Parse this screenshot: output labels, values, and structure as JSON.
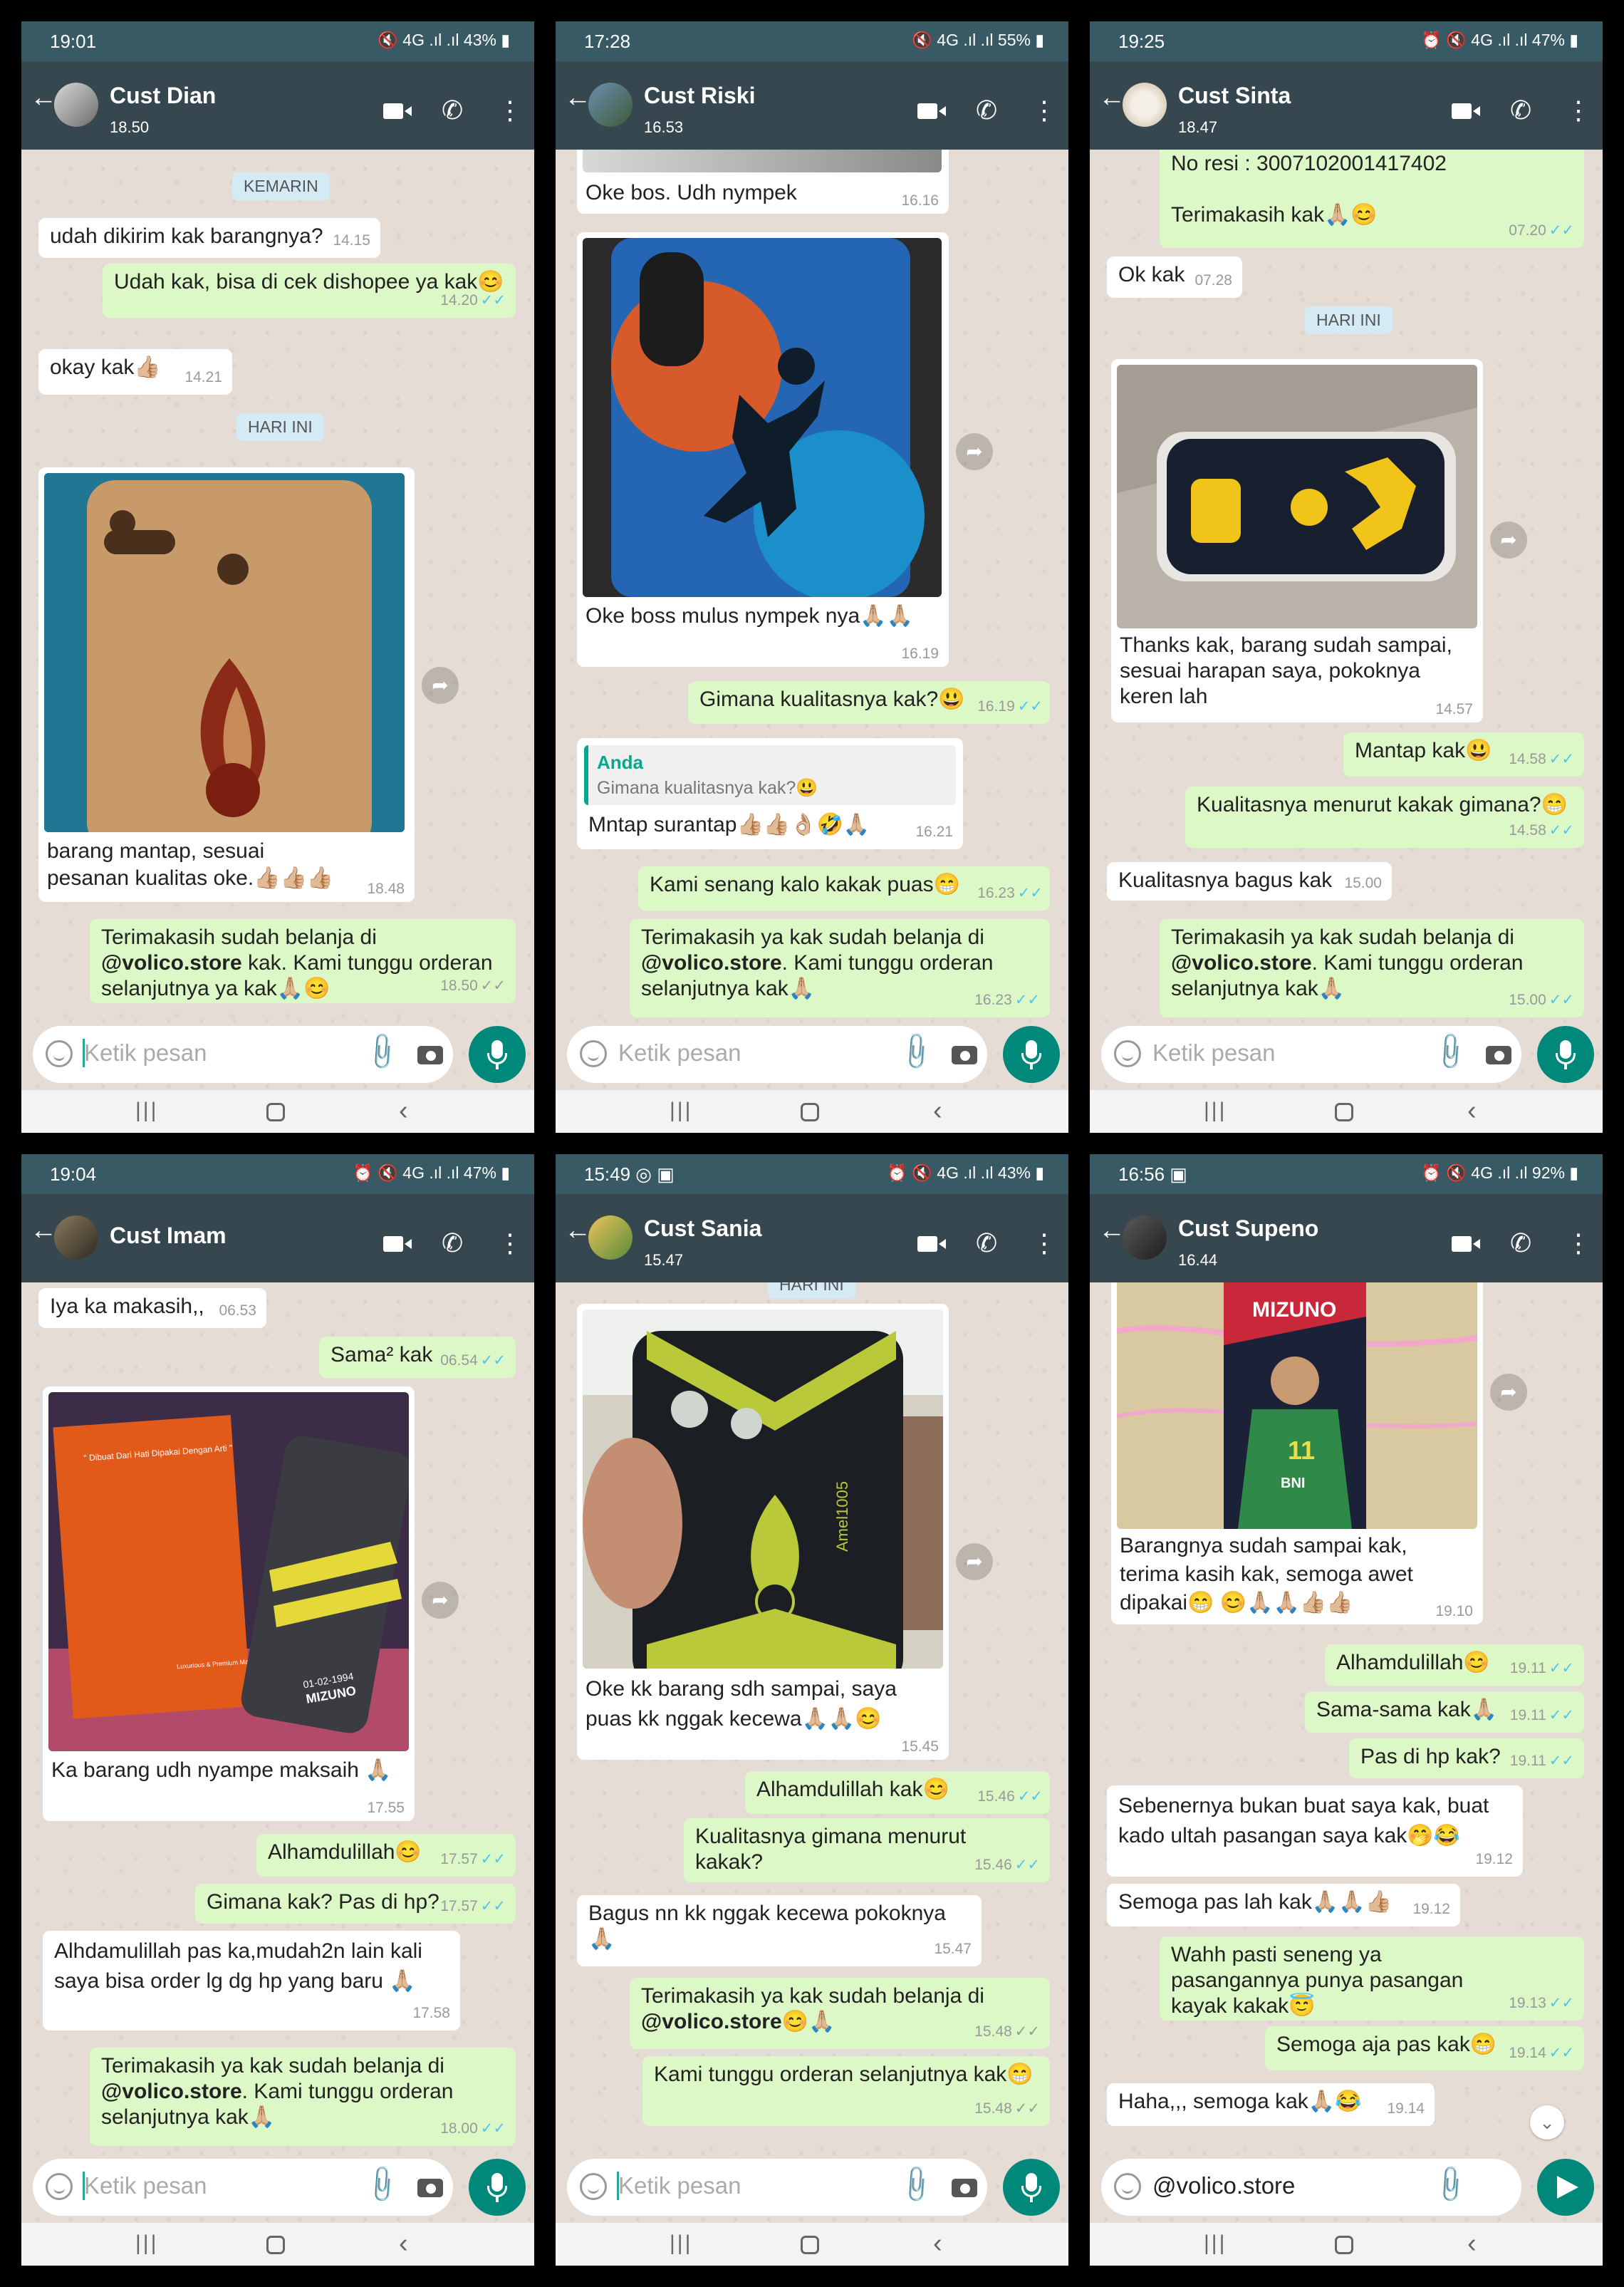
{
  "input_placeholder": "Ketik pesan",
  "panels": [
    {
      "status": {
        "time": "19:01",
        "right": "🔇 4G .ıl .ıl 43% ▮"
      },
      "name": "Cust Dian",
      "last_seen": "18.50",
      "date1": "KEMARIN",
      "date2": "HARI INI",
      "msgs": [
        {
          "text": "udah dikirim kak barangnya?",
          "time": "14.15"
        },
        {
          "text": "Udah kak, bisa di cek dishopee ya kak😊",
          "time": "14.20"
        },
        {
          "text": "okay kak👍🏼",
          "time": "14.21"
        },
        {
          "text": "barang mantap, sesuai pesanan kualitas oke.👍🏼👍🏼👍🏼",
          "time": "18.48"
        },
        {
          "pre": "Terimakasih sudah belanja di ",
          "store": "@volico.store",
          "post": " kak. Kami tunggu orderan selanjutnya ya kak🙏🏼😊",
          "time": "18.50"
        }
      ]
    },
    {
      "status": {
        "time": "17:28",
        "right": "🔇 4G .ıl .ıl 55% ▮"
      },
      "name": "Cust Riski",
      "last_seen": "16.53",
      "msgs": [
        {
          "text": "Oke bos. Udh nympek",
          "time": "16.16"
        },
        {
          "text": "Oke boss mulus nympek nya🙏🏼🙏🏼",
          "time": "16.19"
        },
        {
          "text": "Gimana kualitasnya kak?😃",
          "time": "16.19"
        },
        {
          "text": "Mntap surantap👍🏼👍🏼👌🏼🤣🙏🏼",
          "time": "16.21",
          "quote_who": "Anda",
          "quote_text": "Gimana kualitasnya kak?😃"
        },
        {
          "text": "Kami senang kalo kakak puas😁",
          "time": "16.23"
        },
        {
          "pre": "Terimakasih ya kak sudah belanja di ",
          "store": "@volico.store",
          "post": ". Kami tunggu orderan selanjutnya kak🙏🏼",
          "time": "16.23"
        }
      ]
    },
    {
      "status": {
        "time": "19:25",
        "right": "⏰ 🔇 4G .ıl .ıl 47% ▮"
      },
      "name": "Cust Sinta",
      "last_seen": "18.47",
      "date1": "HARI INI",
      "msgs": [
        {
          "text": "No resi : 3007102001417402",
          "text2": "Terimakasih kak🙏🏼😊",
          "time": "07.20"
        },
        {
          "text": "Ok kak",
          "time": "07.28"
        },
        {
          "text": "Thanks kak, barang sudah sampai, sesuai harapan saya, pokoknya keren lah",
          "time": "14.57"
        },
        {
          "text": "Mantap kak😃",
          "time": "14.58"
        },
        {
          "text": "Kualitasnya menurut kakak gimana?😁",
          "time": "14.58"
        },
        {
          "text": "Kualitasnya bagus kak",
          "time": "15.00"
        },
        {
          "pre": "Terimakasih ya kak sudah belanja di ",
          "store": "@volico.store",
          "post": ". Kami tunggu orderan selanjutnya kak🙏🏼",
          "time": "15.00"
        }
      ]
    },
    {
      "status": {
        "time": "19:04",
        "right": "⏰ 🔇 4G .ıl .ıl 47% ▮"
      },
      "name": "Cust Imam",
      "last_seen": "",
      "msgs": [
        {
          "text": "Iya ka makasih,,",
          "time": "06.53"
        },
        {
          "text": "Sama² kak",
          "time": "06.54"
        },
        {
          "text": "Ka barang udh nyampe maksaih 🙏🏼",
          "time": "17.55"
        },
        {
          "text": "Alhamdulillah😊",
          "time": "17.57"
        },
        {
          "text": "Gimana kak? Pas di hp?",
          "time": "17.57"
        },
        {
          "text": "Alhdamulillah pas ka,mudah2n lain kali saya bisa order lg dg hp yang baru 🙏🏼",
          "time": "17.58"
        },
        {
          "pre": "Terimakasih ya kak sudah belanja di ",
          "store": "@volico.store",
          "post": ". Kami tunggu orderan selanjutnya kak🙏🏼",
          "time": "18.00"
        }
      ],
      "box_text1": "\" Dibuat Dari Hati Dipakai Dengan Arti \"",
      "box_text2": "Luxurious & Premium Material",
      "case_text": "01-02-1994",
      "case_brand": "MIZUNO"
    },
    {
      "status": {
        "time": "15:49 ◎ ▣",
        "right": "⏰ 🔇 4G .ıl .ıl 43% ▮"
      },
      "name": "Cust Sania",
      "last_seen": "15.47",
      "date1": "HARI INI",
      "msgs": [
        {
          "text": "Oke kk barang sdh sampai, saya puas kk nggak kecewa🙏🏼🙏🏼😊",
          "time": "15.45"
        },
        {
          "text": "Alhamdulillah kak😊",
          "time": "15.46"
        },
        {
          "text": "Kualitasnya gimana menurut kakak?",
          "time": "15.46"
        },
        {
          "text": "Bagus nn kk nggak kecewa pokoknya🙏🏼",
          "time": "15.47"
        },
        {
          "pre": "Terimakasih ya kak sudah belanja di ",
          "store": "@volico.store",
          "post": "😊🙏🏼",
          "time": "15.48"
        },
        {
          "text": "Kami tunggu orderan selanjutnya kak😁",
          "time": "15.48"
        }
      ],
      "case_text": "Amel1005"
    },
    {
      "status": {
        "time": "16:56 ▣",
        "right": "⏰ 🔇 4G .ıl .ıl 92% ▮"
      },
      "name": "Cust Supeno",
      "last_seen": "16.44",
      "input_value": "@volico.store",
      "msgs": [
        {
          "text": "Barangnya sudah sampai kak, terima kasih kak, semoga awet dipakai😁 😊🙏🏼🙏🏼👍🏼👍🏼",
          "time": "19.10"
        },
        {
          "text": "Alhamdulillah😊",
          "time": "19.11"
        },
        {
          "text": "Sama-sama kak🙏🏼",
          "time": "19.11"
        },
        {
          "text": "Pas di hp kak?",
          "time": "19.11"
        },
        {
          "text": "Sebenernya bukan buat saya kak, buat kado ultah pasangan saya kak🤭😂",
          "time": "19.12"
        },
        {
          "text": "Semoga pas lah kak🙏🏼🙏🏼👍🏼",
          "time": "19.12"
        },
        {
          "text": "Wahh pasti seneng ya pasangannya punya pasangan kayak kakak😇",
          "time": "19.13"
        },
        {
          "text": "Semoga aja pas kak😁",
          "time": "19.14"
        },
        {
          "text": "Haha,,, semoga kak🙏🏼😂",
          "time": "19.14"
        }
      ],
      "case_brand": "MIZUNO",
      "case_text": "BNI"
    }
  ]
}
